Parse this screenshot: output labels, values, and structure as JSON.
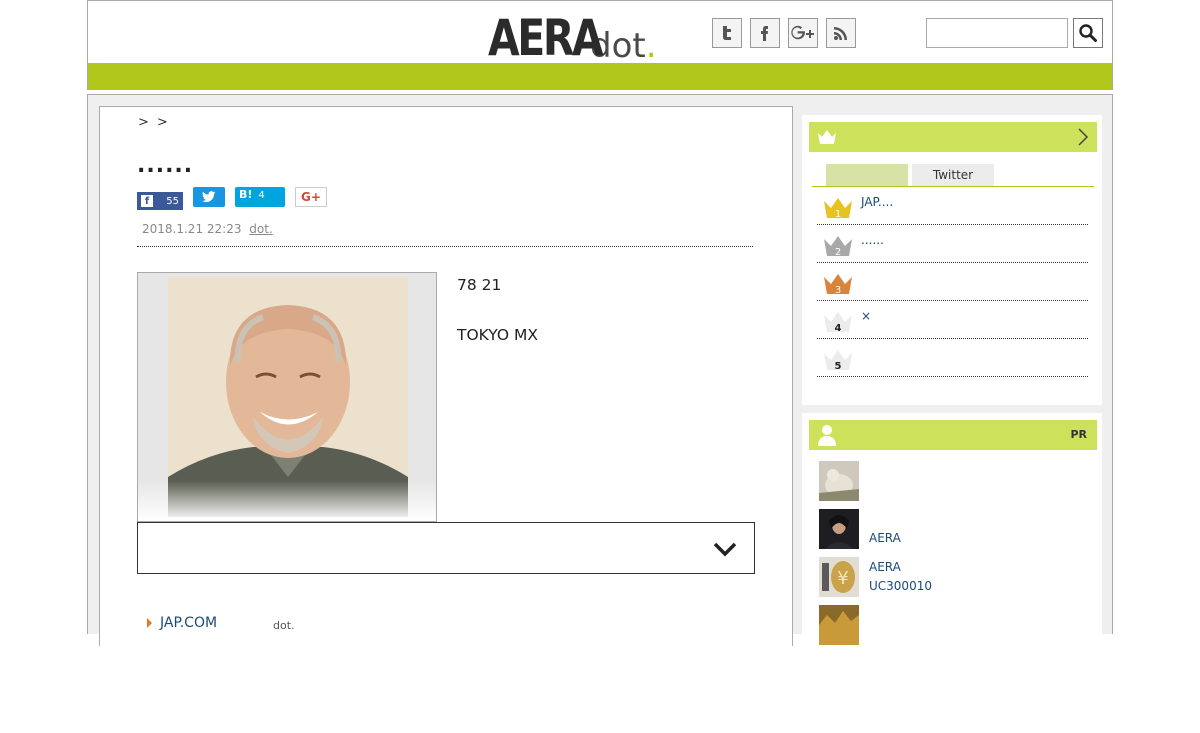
{
  "header": {
    "logo_main": "AERA",
    "logo_sub": "dot",
    "logo_dot": ".",
    "social": [
      {
        "icon": "twitter-icon",
        "glyph": "t"
      },
      {
        "icon": "facebook-icon",
        "glyph": "f"
      },
      {
        "icon": "google-plus-icon",
        "glyph": "G+"
      },
      {
        "icon": "rss-icon",
        "glyph": ""
      }
    ],
    "search_value": ""
  },
  "article": {
    "breadcrumb_sep": ">",
    "title": "......",
    "share": {
      "facebook_count": "55",
      "hatena_label": "B!",
      "hatena_count": "4",
      "google_label": "G+"
    },
    "date": "2018.1.21 22:23",
    "source": "dot.",
    "body": [
      "78 21",
      "TOKYO MX"
    ],
    "related": [
      {
        "label": "JAP.COM",
        "source": "dot."
      }
    ]
  },
  "ranking": {
    "tabs": [
      "",
      "Twitter"
    ],
    "items": [
      {
        "rank": "1",
        "text": "JAP...."
      },
      {
        "rank": "2",
        "text": "......"
      },
      {
        "rank": "3",
        "text": ""
      },
      {
        "rank": "4",
        "text": "×"
      },
      {
        "rank": "5",
        "text": ""
      }
    ]
  },
  "pr": {
    "label": "PR",
    "items": [
      {
        "line1": "",
        "line2": ""
      },
      {
        "line1": "AERA",
        "line2": ""
      },
      {
        "line1": "AERA",
        "line2": "UC300010"
      },
      {
        "line1": "",
        "line2": ""
      }
    ]
  },
  "colors": {
    "accent_green": "#b1c81a",
    "panel_green": "#cde25a",
    "link_blue": "#1a4a7a",
    "gold": "#e8c21e",
    "silver": "#a8a8a8",
    "bronze": "#d9843a"
  }
}
